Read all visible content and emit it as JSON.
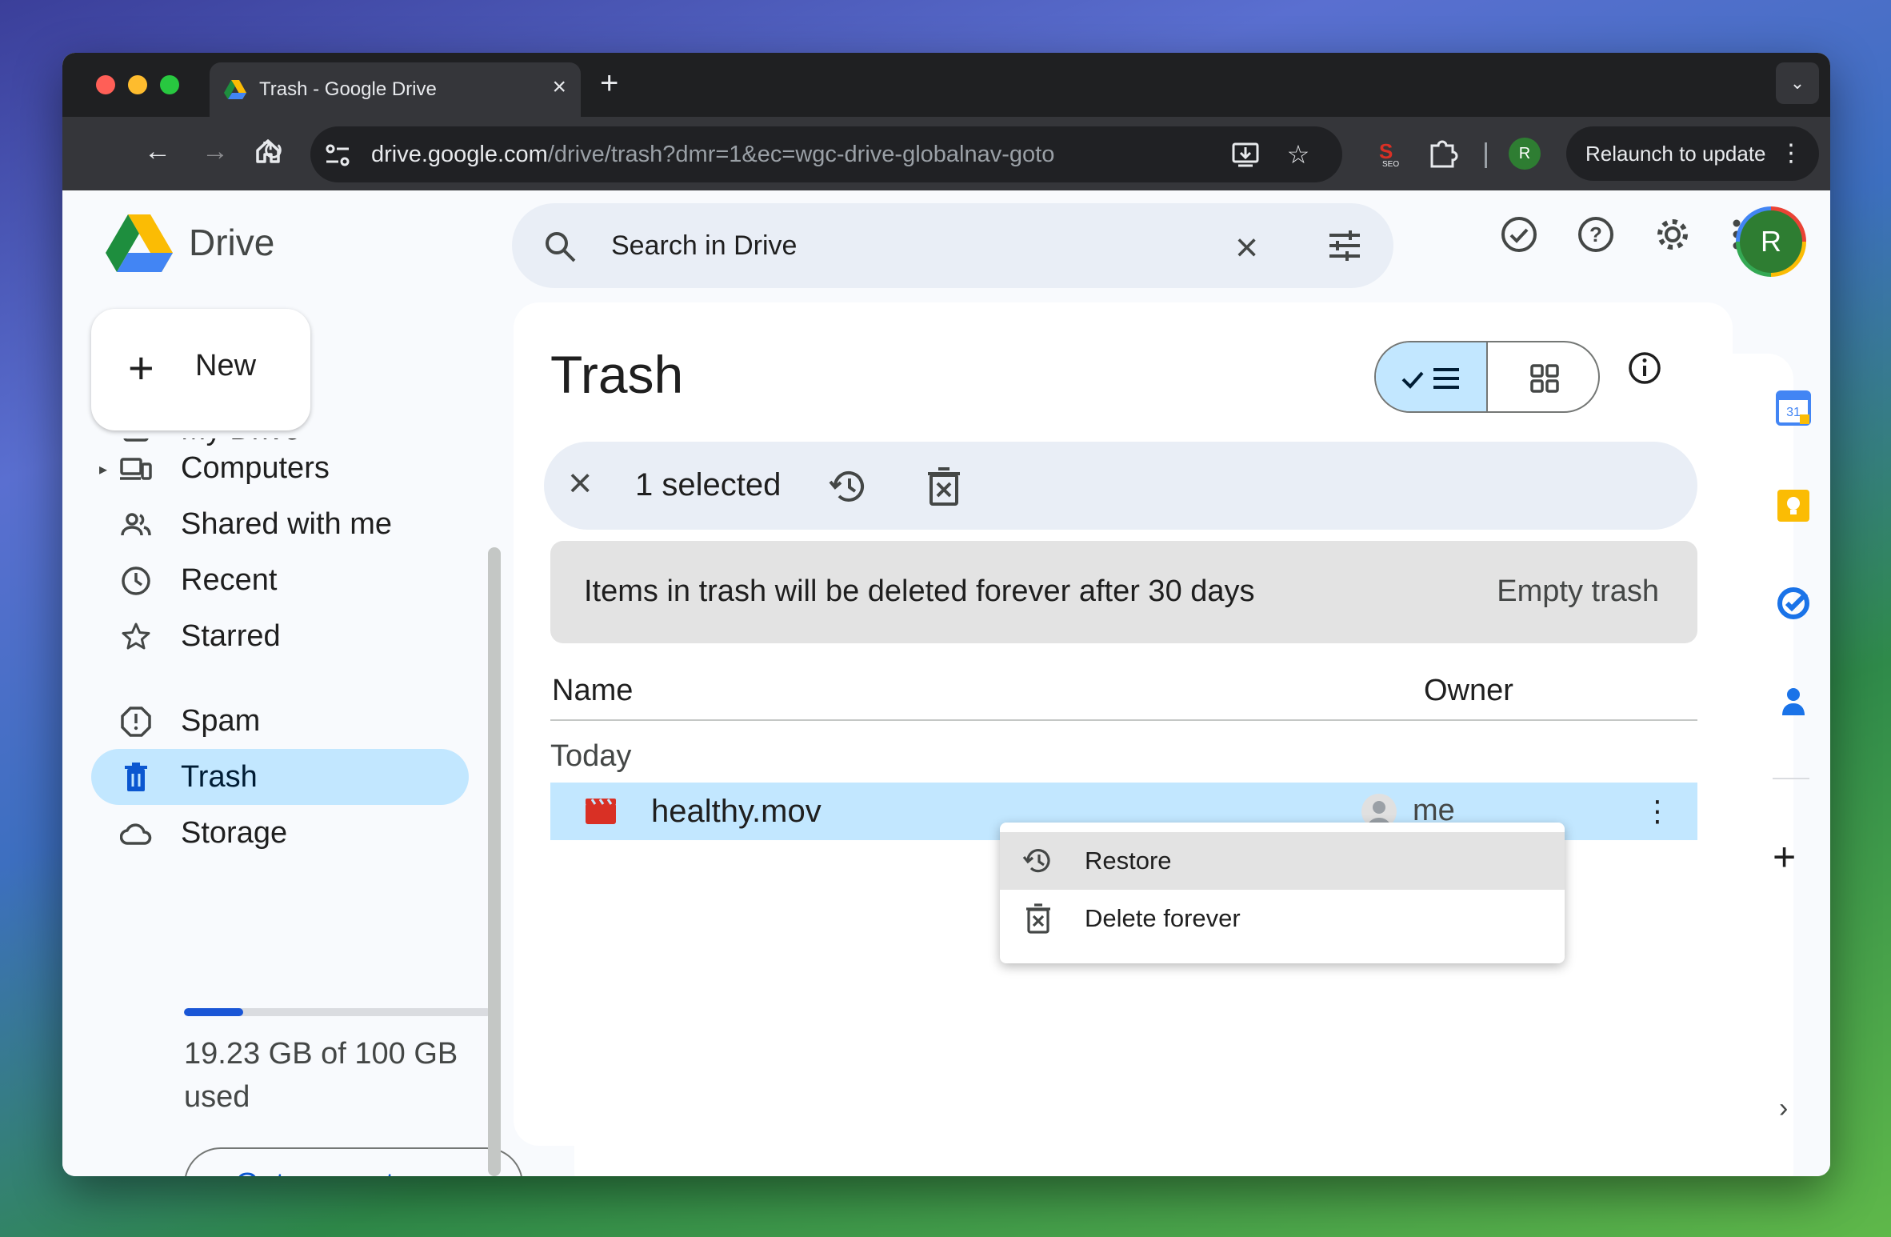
{
  "browser": {
    "tab_title": "Trash - Google Drive",
    "tab_close": "×",
    "new_tab": "+",
    "url_host": "drive.google.com",
    "url_path": "/drive/trash?dmr=1&ec=wgc-drive-globalnav-goto",
    "profile_initial": "R",
    "relaunch_label": "Relaunch to update"
  },
  "header": {
    "brand": "Drive",
    "search_placeholder": "Search in Drive",
    "avatar_initial": "R"
  },
  "sidebar": {
    "new_label": "New",
    "items": [
      {
        "label": "My Drive"
      },
      {
        "label": "Computers"
      },
      {
        "label": "Shared with me"
      },
      {
        "label": "Recent"
      },
      {
        "label": "Starred"
      },
      {
        "label": "Spam"
      },
      {
        "label": "Trash",
        "active": true
      },
      {
        "label": "Storage"
      }
    ],
    "storage": {
      "used_fraction": 0.1923,
      "text": "19.23 GB of 100 GB used",
      "button": "Get more storage"
    }
  },
  "main": {
    "title": "Trash",
    "selection": {
      "count_label": "1 selected"
    },
    "banner": {
      "text": "Items in trash will be deleted forever after 30 days",
      "button": "Empty trash"
    },
    "columns": {
      "name": "Name",
      "owner": "Owner"
    },
    "groups": [
      {
        "label": "Today",
        "files": [
          {
            "name": "healthy.mov",
            "owner": "me",
            "selected": true
          }
        ]
      }
    ]
  },
  "context_menu": {
    "items": [
      {
        "label": "Restore",
        "icon": "restore-icon"
      },
      {
        "label": "Delete forever",
        "icon": "delete-forever-icon"
      }
    ]
  },
  "side_panel": {
    "calendar_day": "31"
  },
  "colors": {
    "accent": "#0b57d0",
    "selected_bg": "#c2e7ff",
    "surface": "#f8fafd"
  }
}
